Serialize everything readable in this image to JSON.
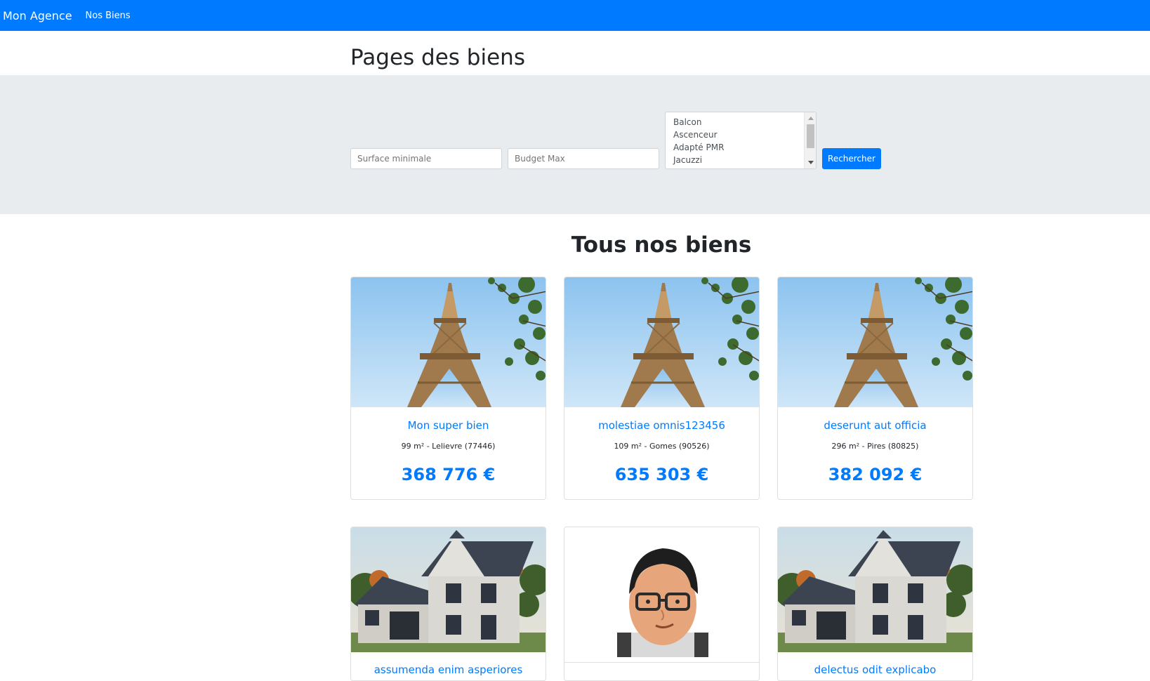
{
  "navbar": {
    "brand": "Mon Agence",
    "link_biens": "Nos Biens"
  },
  "page": {
    "title": "Pages des biens"
  },
  "search": {
    "surface_placeholder": "Surface minimale",
    "budget_placeholder": "Budget Max",
    "options": [
      "Balcon",
      "Ascenceur",
      "Adapté PMR",
      "Jacuzzi"
    ],
    "submit_label": "Rechercher"
  },
  "section": {
    "title": "Tous nos biens"
  },
  "properties": [
    {
      "title": "Mon super bien",
      "meta": "99 m² - Lelievre (77446)",
      "price": "368 776 €",
      "image": "eiffel-tower-photo"
    },
    {
      "title": "molestiae omnis123456",
      "meta": "109 m² - Gomes (90526)",
      "price": "635 303 €",
      "image": "eiffel-tower-photo"
    },
    {
      "title": "deserunt aut officia",
      "meta": "296 m² - Pires (80825)",
      "price": "382 092 €",
      "image": "eiffel-tower-photo"
    },
    {
      "title": "assumenda enim asperiores",
      "image": "house-photo"
    },
    {
      "title": "",
      "image": "cartoon-avatar"
    },
    {
      "title": "delectus odit explicabo",
      "image": "house-photo"
    }
  ],
  "colors": {
    "primary": "#007bff",
    "band": "#e9ecef",
    "text": "#212529"
  }
}
